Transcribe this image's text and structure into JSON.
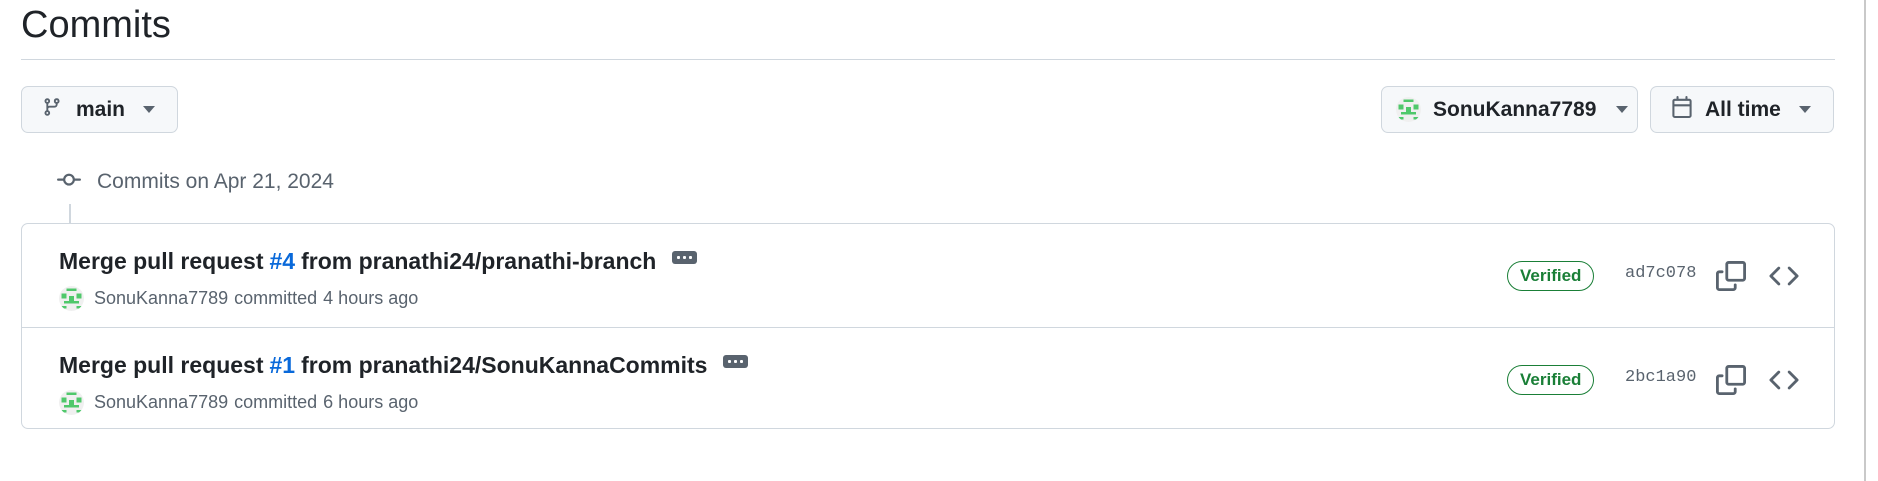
{
  "page": {
    "title": "Commits"
  },
  "filters": {
    "branch": {
      "label": "main",
      "icon": "git-branch-icon"
    },
    "author": {
      "label": "SonuKanna7789",
      "icon": "avatar"
    },
    "time": {
      "label": "All time",
      "icon": "calendar-icon"
    }
  },
  "group": {
    "label": "Commits on Apr 21, 2024",
    "icon": "git-commit-icon"
  },
  "commits": [
    {
      "title_prefix": "Merge pull request",
      "pr": "#4",
      "title_suffix": "from pranathi24/pranathi-branch",
      "author": "SonuKanna7789",
      "verb": "committed",
      "when": "4 hours ago",
      "badge": "Verified",
      "sha": "ad7c078"
    },
    {
      "title_prefix": "Merge pull request",
      "pr": "#1",
      "title_suffix": "from pranathi24/SonuKannaCommits",
      "author": "SonuKanna7789",
      "verb": "committed",
      "when": "6 hours ago",
      "badge": "Verified",
      "sha": "2bc1a90"
    }
  ],
  "colors": {
    "link": "#0969da",
    "verified": "#1a7f37",
    "muted": "#59636e",
    "border": "#d0d7de",
    "avatar_green": "#4fc86b"
  }
}
